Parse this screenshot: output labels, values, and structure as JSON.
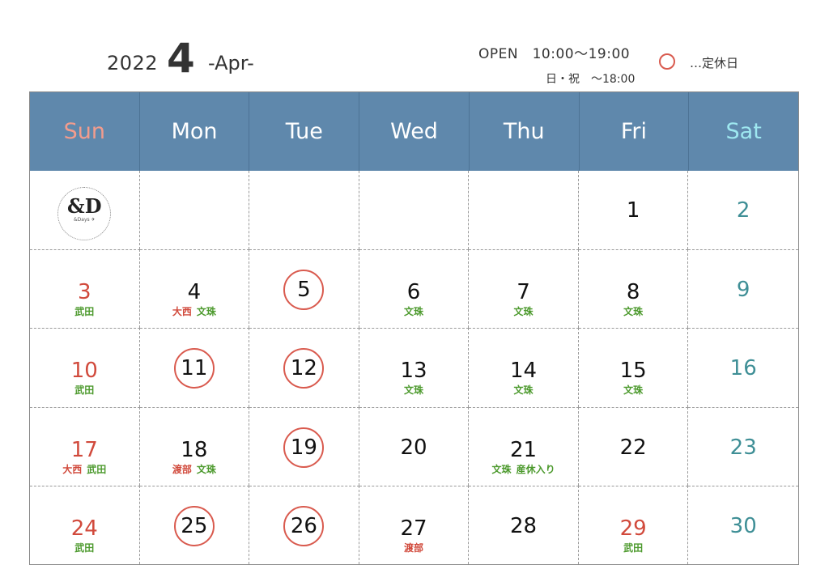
{
  "header": {
    "year": "2022",
    "month": "4",
    "month_en": "-Apr-",
    "open_hours": "OPEN　10:00〜19:00",
    "sunday_hours": "日・祝　〜18:00",
    "legend": "…定休日"
  },
  "logo": {
    "mark": "&D",
    "sub": "&Days ✈"
  },
  "weekdays": [
    "Sun",
    "Mon",
    "Tue",
    "Wed",
    "Thu",
    "Fri",
    "Sat"
  ],
  "colors": {
    "header_bg": "#5f88ac",
    "holiday_red": "#d14a3c",
    "saturday_teal": "#3f8f96",
    "ring": "#d95a4e",
    "staff_green": "#4d9a2e"
  },
  "weeks": [
    [
      {
        "logo": true
      },
      {
        "day": ""
      },
      {
        "day": ""
      },
      {
        "day": ""
      },
      {
        "day": ""
      },
      {
        "day": "1"
      },
      {
        "day": "2",
        "color": "teal"
      }
    ],
    [
      {
        "day": "3",
        "color": "red",
        "notes": [
          {
            "t": "武田",
            "c": "green"
          }
        ]
      },
      {
        "day": "4",
        "notes": [
          {
            "t": "大西",
            "c": "red"
          },
          {
            "t": "文珠",
            "c": "green"
          }
        ]
      },
      {
        "day": "5",
        "closed": true
      },
      {
        "day": "6",
        "notes": [
          {
            "t": "文珠",
            "c": "green"
          }
        ]
      },
      {
        "day": "7",
        "notes": [
          {
            "t": "文珠",
            "c": "green"
          }
        ]
      },
      {
        "day": "8",
        "notes": [
          {
            "t": "文珠",
            "c": "green"
          }
        ]
      },
      {
        "day": "9",
        "color": "teal"
      }
    ],
    [
      {
        "day": "10",
        "color": "red",
        "notes": [
          {
            "t": "武田",
            "c": "green"
          }
        ]
      },
      {
        "day": "11",
        "closed": true
      },
      {
        "day": "12",
        "closed": true
      },
      {
        "day": "13",
        "notes": [
          {
            "t": "文珠",
            "c": "green"
          }
        ]
      },
      {
        "day": "14",
        "notes": [
          {
            "t": "文珠",
            "c": "green"
          }
        ]
      },
      {
        "day": "15",
        "notes": [
          {
            "t": "文珠",
            "c": "green"
          }
        ]
      },
      {
        "day": "16",
        "color": "teal"
      }
    ],
    [
      {
        "day": "17",
        "color": "red",
        "notes": [
          {
            "t": "大西",
            "c": "red"
          },
          {
            "t": "武田",
            "c": "green"
          }
        ]
      },
      {
        "day": "18",
        "notes": [
          {
            "t": "渡部",
            "c": "red"
          },
          {
            "t": "文珠",
            "c": "green"
          }
        ]
      },
      {
        "day": "19",
        "closed": true
      },
      {
        "day": "20"
      },
      {
        "day": "21",
        "notes": [
          {
            "t": "文珠",
            "c": "green"
          },
          {
            "t": "産休入り",
            "c": "green"
          }
        ]
      },
      {
        "day": "22"
      },
      {
        "day": "23",
        "color": "teal"
      }
    ],
    [
      {
        "day": "24",
        "color": "red",
        "notes": [
          {
            "t": "武田",
            "c": "green"
          }
        ]
      },
      {
        "day": "25",
        "closed": true
      },
      {
        "day": "26",
        "closed": true
      },
      {
        "day": "27",
        "notes": [
          {
            "t": "渡部",
            "c": "red"
          }
        ]
      },
      {
        "day": "28"
      },
      {
        "day": "29",
        "color": "red",
        "notes": [
          {
            "t": "武田",
            "c": "green"
          }
        ]
      },
      {
        "day": "30",
        "color": "teal"
      }
    ]
  ]
}
